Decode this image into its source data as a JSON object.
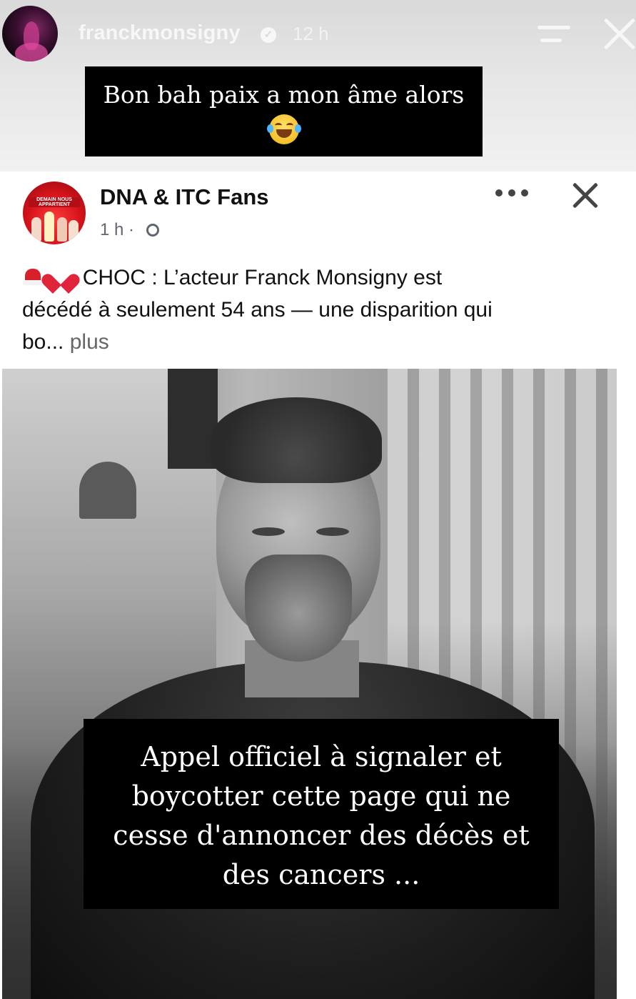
{
  "story": {
    "username": "franckmonsigny",
    "time": "12 h",
    "caption_line1": "Bon bah paix a mon âme alors",
    "caption_emoji": "face-with-tears-of-joy-icon"
  },
  "post": {
    "page_name": "DNA & ITC Fans",
    "meta_time": "1 h ·",
    "avatar_text": "DEMAIN NOUS APPARTIENT",
    "text_lead": "CHOC : L’acteur Franck Monsigny est",
    "text_line2": "décédé à seulement 54 ans — une disparition qui",
    "text_line3": "bo...",
    "see_more": "plus",
    "emojis": [
      "santa-hat-icon",
      "broken-heart-icon"
    ]
  },
  "photo": {
    "overlay_lines": [
      "Appel officiel à signaler et",
      "boycotter cette page qui ne",
      "cesse d'annoncer des décès et",
      "des cancers ..."
    ]
  },
  "colors": {
    "caption_bg": "#000000",
    "caption_text": "#ffffff",
    "meta": "#606770",
    "heart": "#e0243a"
  }
}
